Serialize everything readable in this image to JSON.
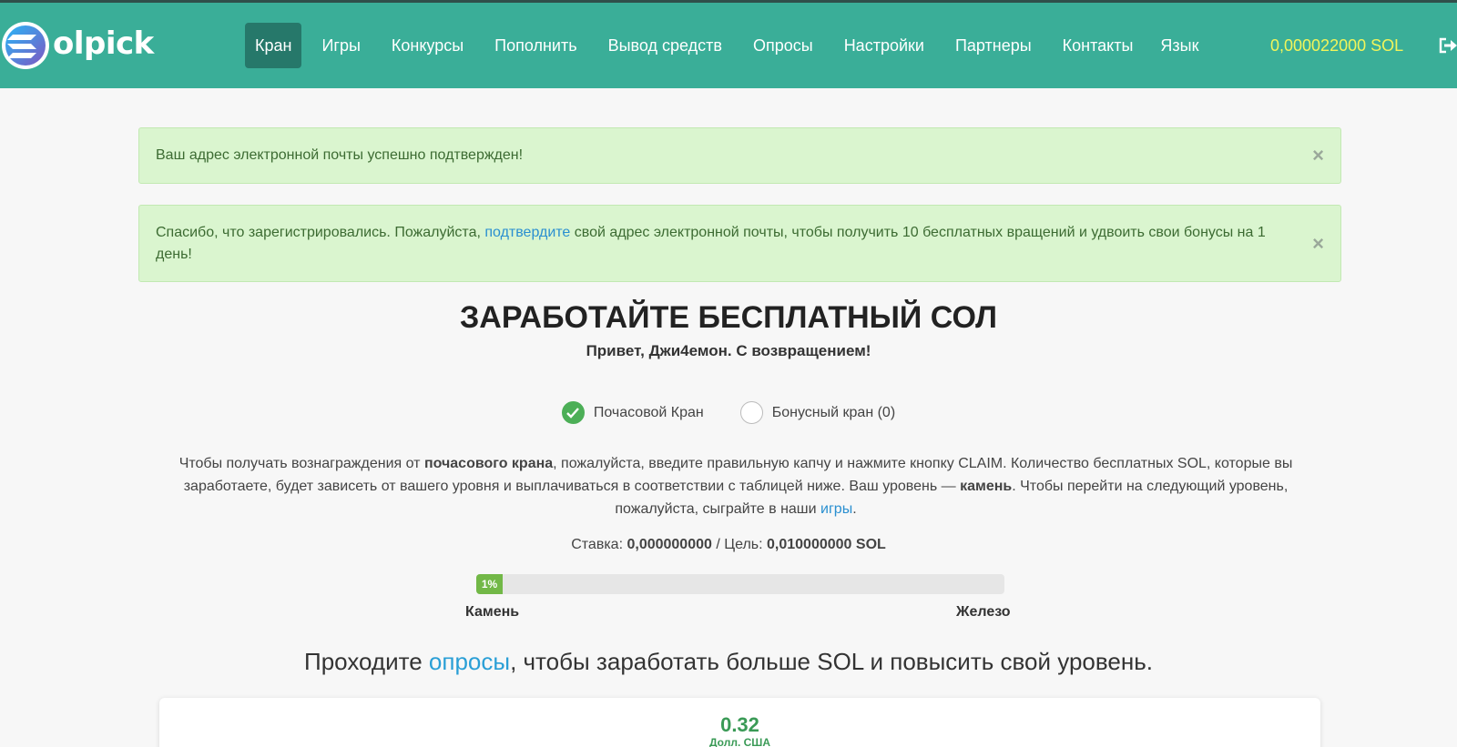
{
  "header": {
    "logo_text": "olpick",
    "nav": [
      {
        "label": "Кран",
        "active": true
      },
      {
        "label": "Игры"
      },
      {
        "label": "Конкурсы"
      },
      {
        "label": "Пополнить"
      },
      {
        "label": "Вывод средств"
      },
      {
        "label": "Опросы"
      },
      {
        "label": "Настройки"
      },
      {
        "label": "Партнеры"
      },
      {
        "label": "Контакты"
      },
      {
        "label": "Язык"
      }
    ],
    "balance": "0,000022000 SOL",
    "logout_icon": "logout-icon"
  },
  "alerts": {
    "email_confirmed": "Ваш адрес электронной почты успешно подтвержден!",
    "register_before": "Спасибо, что зарегистрировались. Пожалуйста, ",
    "register_link": "подтвердите",
    "register_after": " свой адрес электронной почты, чтобы получить 10 бесплатных вращений и удвоить свои бонусы на 1 день!",
    "close": "×"
  },
  "main": {
    "title": "ЗАРАБОТАЙТЕ БЕСПЛАТНЫЙ СОЛ",
    "greeting": "Привет, Джи4емон. С возвращением!",
    "radio_hourly": "Почасовой Кран",
    "radio_bonus": "Бонусный кран (0)",
    "desc": {
      "p1": "Чтобы получать вознаграждения от ",
      "b1": "почасового крана",
      "p2": ", пожалуйста, введите правильную капчу и нажмите кнопку CLAIM. Количество бесплатных SOL, которые вы заработаете, будет зависеть от вашего уровня и выплачиваться в соответствии с таблицей ниже. Ваш уровень — ",
      "b2": "камень",
      "p3": ". Чтобы перейти на следующий уровень, пожалуйста, сыграйте в наши ",
      "link": "игры",
      "p4": "."
    },
    "rate_label": "Ставка: ",
    "rate_value": "0,000000000",
    "goal_label": " / Цель: ",
    "goal_value": "0,010000000 SOL",
    "progress_percent": 1,
    "progress_label": "1%",
    "level_current": "Камень",
    "level_next": "Железо",
    "surveys_before": "Проходите ",
    "surveys_link": "опросы",
    "surveys_after": ", чтобы заработать больше SOL и повысить свой уровень.",
    "card_amount": "0.32",
    "card_currency": "Долл. США"
  },
  "colors": {
    "navbar": "#3aae98",
    "active_nav": "#26786a",
    "balance": "#f2f55a",
    "alert_bg": "#daf5cf",
    "link": "#2a8fd0",
    "progress_fill": "#72b847"
  }
}
